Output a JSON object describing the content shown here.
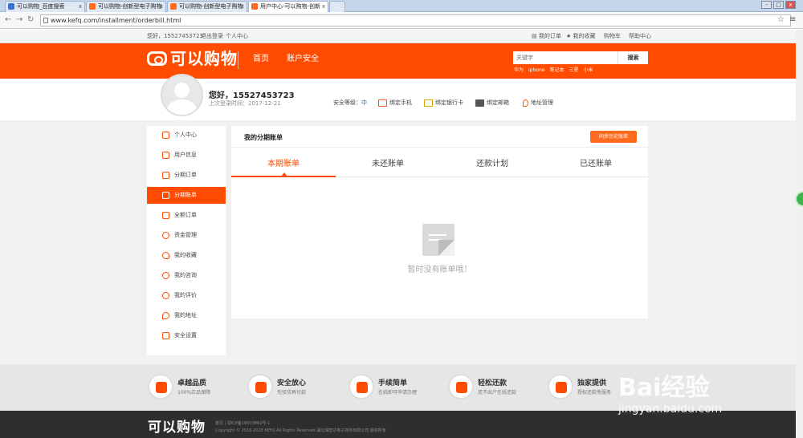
{
  "browser": {
    "tabs": [
      {
        "label": "可以购物_百度搜索",
        "color": "#3b6fd8"
      },
      {
        "label": "可以购物-创新型电子购物",
        "color": "#ff6a1f"
      },
      {
        "label": "可以购物-创新型电子购物",
        "color": "#ff6a1f"
      },
      {
        "label": "用户中心-可以购物-创新",
        "color": "#ff6a1f"
      }
    ],
    "url": "www.kefq.com/installment/orderbill.html",
    "window_buttons": [
      "-",
      "□",
      "x"
    ]
  },
  "topbar": {
    "greeting": "您好，15527453723",
    "logout": "退出登录",
    "profile": "个人中心",
    "my_orders": "我的订单",
    "my_favorites": "我的收藏",
    "cart": "购物车",
    "help": "帮助中心"
  },
  "header": {
    "logo": "可以购物",
    "nav": [
      "首页",
      "账户安全"
    ],
    "search_placeholder": "关键字",
    "search_button": "搜索",
    "hotwords": [
      "华为",
      "iphone",
      "笔记本",
      "三星",
      "小米"
    ],
    "brand_color": "#ff4c00"
  },
  "user": {
    "greeting": "您好，15527453723",
    "last_login": "上次登录时间：2017-12-21",
    "security_level_label": "安全等级：",
    "security_level": "中",
    "actions": [
      "绑定手机",
      "绑定银行卡",
      "绑定邮箱",
      "地址管理"
    ]
  },
  "sidebar": {
    "items": [
      {
        "label": "个人中心",
        "icon": "home-icon"
      },
      {
        "label": "用户信息",
        "icon": "users-icon"
      },
      {
        "label": "分期订单",
        "icon": "order-icon"
      },
      {
        "label": "分期账单",
        "icon": "bill-icon",
        "active": true
      },
      {
        "label": "全额订单",
        "icon": "list-icon"
      },
      {
        "label": "资金管理",
        "icon": "money-icon"
      },
      {
        "label": "我的收藏",
        "icon": "heart-icon"
      },
      {
        "label": "我的咨询",
        "icon": "chat-icon"
      },
      {
        "label": "我的评价",
        "icon": "comment-icon"
      },
      {
        "label": "我的地址",
        "icon": "location-icon"
      },
      {
        "label": "安全设置",
        "icon": "lock-icon"
      }
    ]
  },
  "main": {
    "title": "我的分期账单",
    "sync_button": "同步历史账单",
    "tabs": [
      "本期账单",
      "未还账单",
      "还款计划",
      "已还账单"
    ],
    "active_tab": 0,
    "empty_text": "暂时没有账单哦！"
  },
  "features": [
    {
      "title": "卓越品质",
      "sub": "100%正品保障"
    },
    {
      "title": "安全放心",
      "sub": "先验货再付款"
    },
    {
      "title": "手续简单",
      "sub": "在线即可申请办理"
    },
    {
      "title": "轻松还款",
      "sub": "足不出户在线还款"
    },
    {
      "title": "独家提供",
      "sub": "授权还款免服务"
    }
  ],
  "footer": {
    "logo": "可以购物",
    "line1": "首页 | 鄂ICP备16013862号-1",
    "line2": "Copyright © 2016-2018 KEFQ All Rights Reserved 湖北瑞智达电子商务有限公司 版权所有"
  },
  "watermark": {
    "big": "Bai经验",
    "small": "jingyan.baidu.com"
  }
}
